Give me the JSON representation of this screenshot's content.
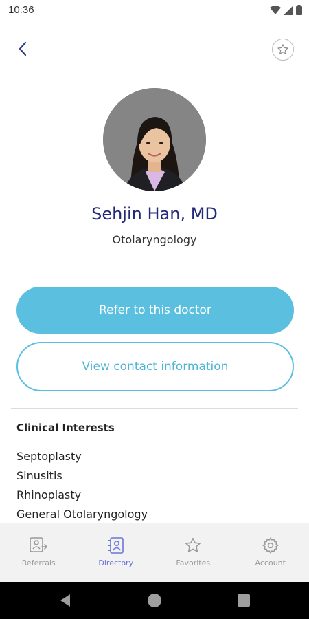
{
  "status_bar": {
    "time": "10:36"
  },
  "profile": {
    "name": "Sehjin Han, MD",
    "specialty": "Otolaryngology"
  },
  "actions": {
    "refer_label": "Refer to this doctor",
    "contact_label": "View contact information"
  },
  "clinical_interests": {
    "title": "Clinical Interests",
    "items": [
      "Septoplasty",
      "Sinusitis",
      "Rhinoplasty",
      "General Otolaryngology"
    ]
  },
  "bottom_nav": {
    "items": [
      {
        "label": "Referrals",
        "icon": "referrals-icon",
        "active": false
      },
      {
        "label": "Directory",
        "icon": "directory-icon",
        "active": true
      },
      {
        "label": "Favorites",
        "icon": "star-icon",
        "active": false
      },
      {
        "label": "Account",
        "icon": "gear-icon",
        "active": false
      }
    ]
  },
  "colors": {
    "accent": "#5bc0e0",
    "name": "#232a7a",
    "nav_active": "#6d75d8",
    "nav_inactive": "#9a9a9a"
  }
}
